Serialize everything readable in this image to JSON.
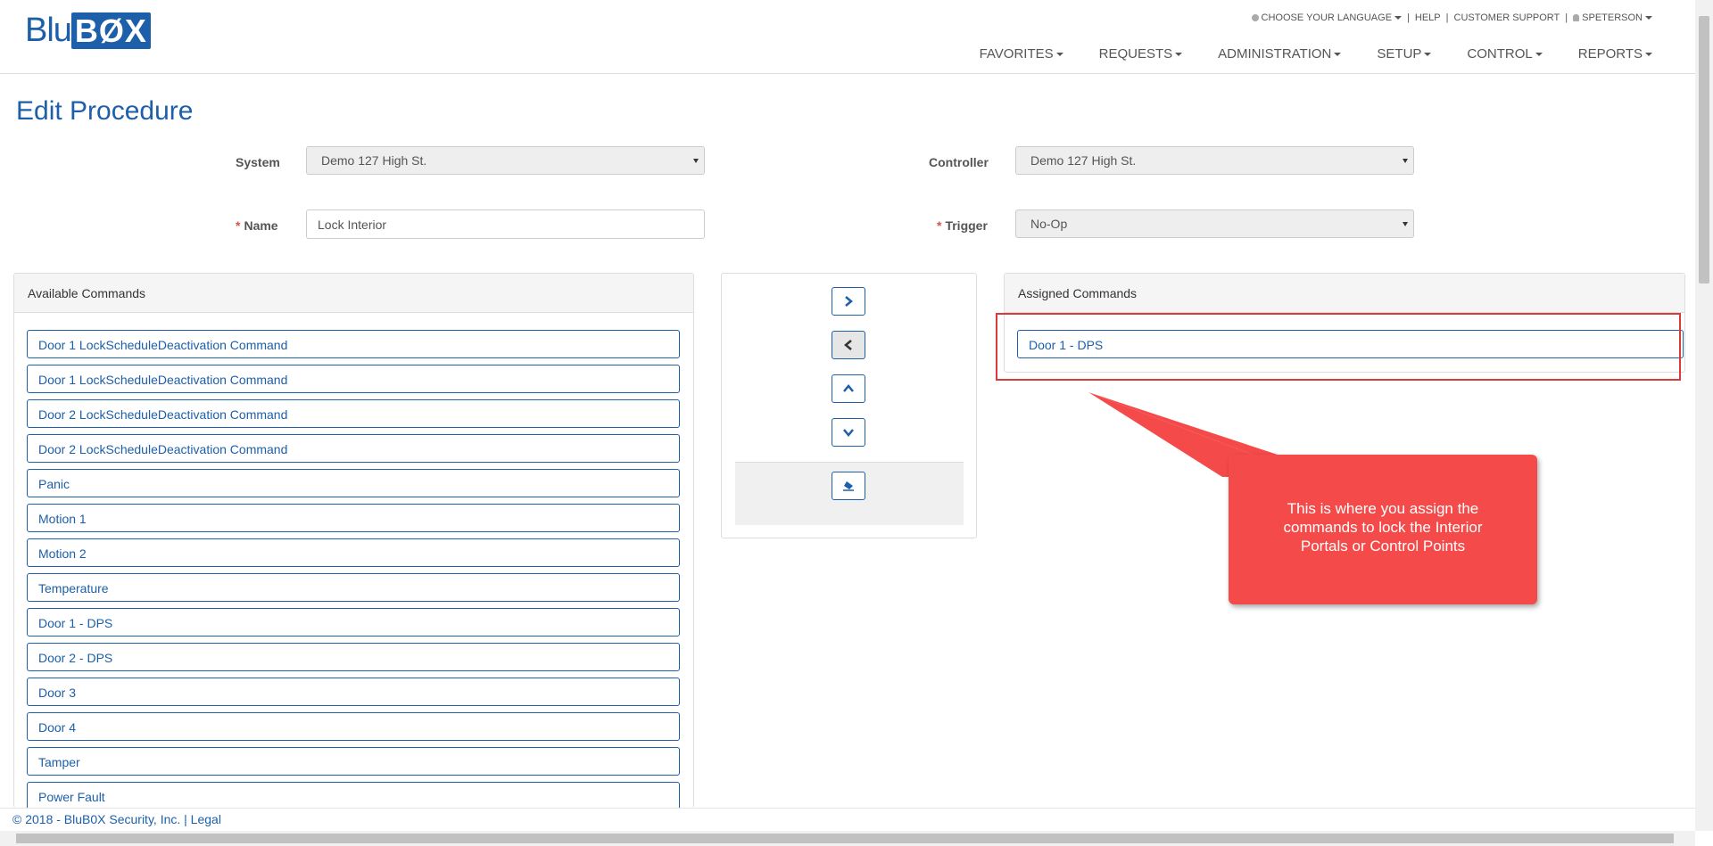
{
  "brand": {
    "part1": "Blu",
    "part2": "BØX"
  },
  "toplinks": {
    "language": "CHOOSE YOUR LANGUAGE",
    "help": "HELP",
    "support": "CUSTOMER SUPPORT",
    "user": "SPETERSON",
    "separator": "|"
  },
  "nav": [
    "FAVORITES",
    "REQUESTS",
    "ADMINISTRATION",
    "SETUP",
    "CONTROL",
    "REPORTS"
  ],
  "page_title": "Edit Procedure",
  "form": {
    "system_label": "System",
    "system_value": "Demo 127 High St.",
    "controller_label": "Controller",
    "controller_value": "Demo 127 High St.",
    "required_mark": "*",
    "name_label": "Name",
    "name_value": "Lock Interior",
    "trigger_label": "Trigger",
    "trigger_value": "No-Op"
  },
  "available": {
    "title": "Available Commands",
    "items": [
      "Door 1 LockScheduleDeactivation Command",
      "Door 1 LockScheduleDeactivation Command",
      "Door 2 LockScheduleDeactivation Command",
      "Door 2 LockScheduleDeactivation Command",
      "Panic",
      "Motion 1",
      "Motion 2",
      "Temperature",
      "Door 1 - DPS",
      "Door 2 - DPS",
      "Door 3",
      "Door 4",
      "Tamper",
      "Power Fault"
    ]
  },
  "assigned": {
    "title": "Assigned Commands",
    "items": [
      "Door 1 - DPS"
    ]
  },
  "callout": "This is where you assign the commands to lock the Interior Portals or Control Points",
  "footer": {
    "copyright": "© 2018 - BluB0X Security, Inc. | ",
    "legal": "Legal"
  },
  "colors": {
    "brand": "#1d5fa8",
    "callout": "#f54a4a",
    "required": "#d9534f"
  }
}
